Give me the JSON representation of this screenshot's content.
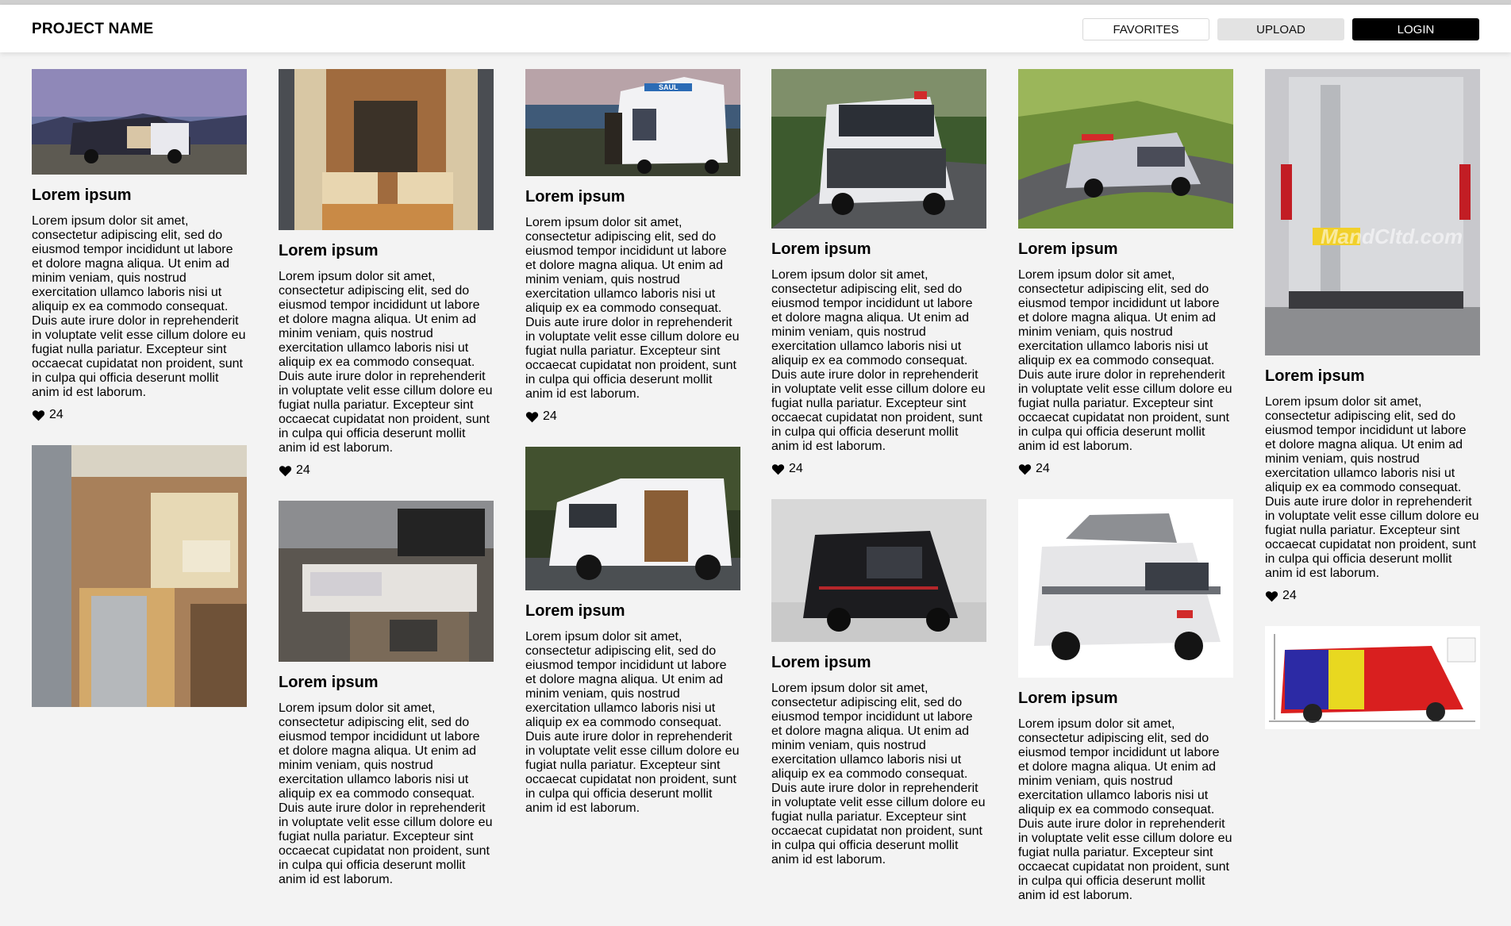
{
  "header": {
    "project_name": "PROJECT NAME",
    "nav": {
      "favorites_label": "FAVORITES",
      "upload_label": "UPLOAD",
      "login_label": "LOGIN"
    }
  },
  "card": {
    "title": "Lorem ipsum",
    "body": "Lorem ipsum dolor sit amet, consectetur adipiscing elit, sed do eiusmod tempor incididunt ut labore et dolore magna aliqua. Ut enim ad minim veniam, quis nostrud exercitation ullamco laboris nisi ut aliquip ex ea commodo consequat. Duis aute irure dolor in reprehenderit in voluptate velit esse cillum dolore eu fugiat nulla pariatur. Excepteur sint occaecat cupidatat non proident, sunt in culpa qui officia deserunt mollit anim id est laborum.",
    "likes": "24",
    "like_icon": "heart-icon"
  },
  "image_text": {
    "van_lettering": "SAUL",
    "watermark": "MandCltd.com"
  },
  "colors": {
    "header_bg": "#ffffff",
    "page_bg": "#f3f3f3",
    "login_bg": "#000000",
    "upload_bg": "#e3e3e3"
  }
}
